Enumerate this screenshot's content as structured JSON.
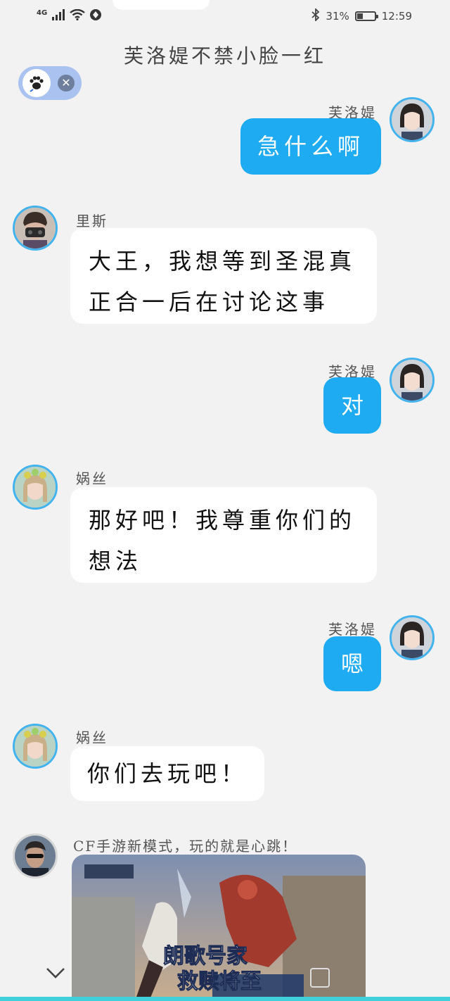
{
  "status_bar": {
    "network": "4G",
    "battery_percent": "31%",
    "battery_level": 0.31,
    "time": "12:59"
  },
  "chat": {
    "title": "芙洛媞不禁小脸一红"
  },
  "messages": [
    {
      "sender": "芙洛媞",
      "text": "急什么啊",
      "direction": "out"
    },
    {
      "sender": "里斯",
      "lines": [
        "大王，我想等到圣混真",
        "正合一后在讨论这事"
      ],
      "direction": "in"
    },
    {
      "sender": "芙洛媞",
      "text": "对",
      "direction": "out"
    },
    {
      "sender": "娲丝",
      "lines": [
        "那好吧！我尊重你们的",
        "想法"
      ],
      "direction": "in"
    },
    {
      "sender": "芙洛媞",
      "text": "嗯",
      "direction": "out"
    },
    {
      "sender": "娲丝",
      "text": "你们去玩吧！",
      "direction": "in"
    }
  ],
  "ad": {
    "caption": "CF手游新模式，玩的就是心跳！",
    "banner_title_line1": "朗歌号家",
    "banner_title_line2": "救赎将至"
  },
  "colors": {
    "accent": "#1eabf1",
    "avatar_ring": "#43b3ee",
    "background": "#f2f2f2",
    "bubble_in": "#ffffff"
  }
}
